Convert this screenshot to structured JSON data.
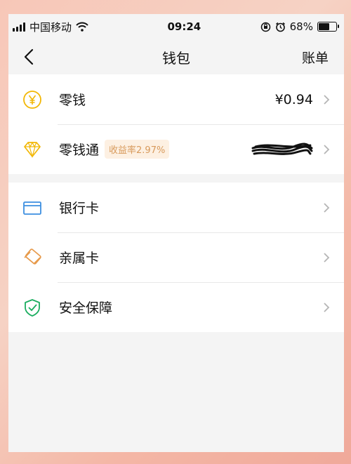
{
  "status_bar": {
    "carrier": "中国移动",
    "time": "09:24",
    "battery_percent": "68%",
    "battery_level": 0.68,
    "icons": [
      "signal-icon",
      "wifi-icon",
      "rotation-lock-icon",
      "alarm-icon",
      "battery-icon"
    ]
  },
  "nav": {
    "title": "钱包",
    "right_label": "账单"
  },
  "wallet_items": [
    {
      "label": "零钱",
      "value": "¥0.94",
      "icon": "coin-yen-icon",
      "color": "#f2b705"
    },
    {
      "label": "零钱通",
      "badge": "收益率2.97%",
      "value_obscured": true,
      "icon": "diamond-icon",
      "color": "#f2b705"
    }
  ],
  "service_items": [
    {
      "label": "银行卡",
      "icon": "bank-card-icon",
      "color": "#3d8fe0"
    },
    {
      "label": "亲属卡",
      "icon": "family-card-icon",
      "color": "#e79a4b"
    },
    {
      "label": "安全保障",
      "icon": "security-shield-icon",
      "color": "#1aad5f"
    }
  ]
}
